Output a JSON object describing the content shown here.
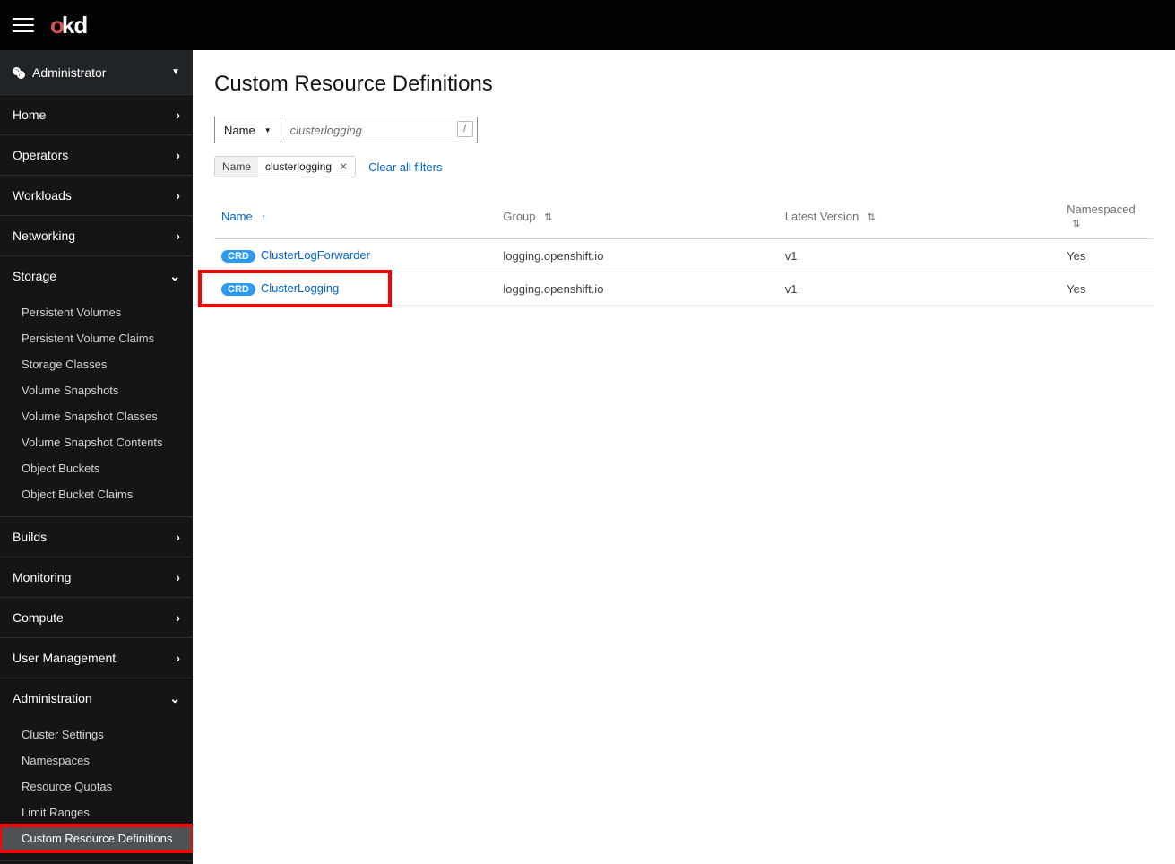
{
  "masthead": {
    "logo_o": "o",
    "logo_kd": "kd"
  },
  "perspective": {
    "label": "Administrator"
  },
  "sidebar": [
    {
      "label": "Home",
      "expanded": false,
      "items": []
    },
    {
      "label": "Operators",
      "expanded": false,
      "items": []
    },
    {
      "label": "Workloads",
      "expanded": false,
      "items": []
    },
    {
      "label": "Networking",
      "expanded": false,
      "items": []
    },
    {
      "label": "Storage",
      "expanded": true,
      "items": [
        {
          "label": "Persistent Volumes"
        },
        {
          "label": "Persistent Volume Claims"
        },
        {
          "label": "Storage Classes"
        },
        {
          "label": "Volume Snapshots"
        },
        {
          "label": "Volume Snapshot Classes"
        },
        {
          "label": "Volume Snapshot Contents"
        },
        {
          "label": "Object Buckets"
        },
        {
          "label": "Object Bucket Claims"
        }
      ]
    },
    {
      "label": "Builds",
      "expanded": false,
      "items": []
    },
    {
      "label": "Monitoring",
      "expanded": false,
      "items": []
    },
    {
      "label": "Compute",
      "expanded": false,
      "items": []
    },
    {
      "label": "User Management",
      "expanded": false,
      "items": []
    },
    {
      "label": "Administration",
      "expanded": true,
      "items": [
        {
          "label": "Cluster Settings"
        },
        {
          "label": "Namespaces"
        },
        {
          "label": "Resource Quotas"
        },
        {
          "label": "Limit Ranges"
        },
        {
          "label": "Custom Resource Definitions",
          "active": true,
          "highlight": true
        }
      ]
    }
  ],
  "page": {
    "title": "Custom Resource Definitions",
    "filter_type": "Name",
    "filter_value": "clusterlogging",
    "filter_hint": "/",
    "chip": {
      "label": "Name",
      "value": "clusterlogging"
    },
    "clear_filters": "Clear all filters",
    "columns": {
      "name": "Name",
      "group": "Group",
      "version": "Latest Version",
      "ns": "Namespaced"
    },
    "badge": "CRD",
    "rows": [
      {
        "name": "ClusterLogForwarder",
        "group": "logging.openshift.io",
        "version": "v1",
        "ns": "Yes",
        "highlight": false
      },
      {
        "name": "ClusterLogging",
        "group": "logging.openshift.io",
        "version": "v1",
        "ns": "Yes",
        "highlight": true
      }
    ]
  }
}
